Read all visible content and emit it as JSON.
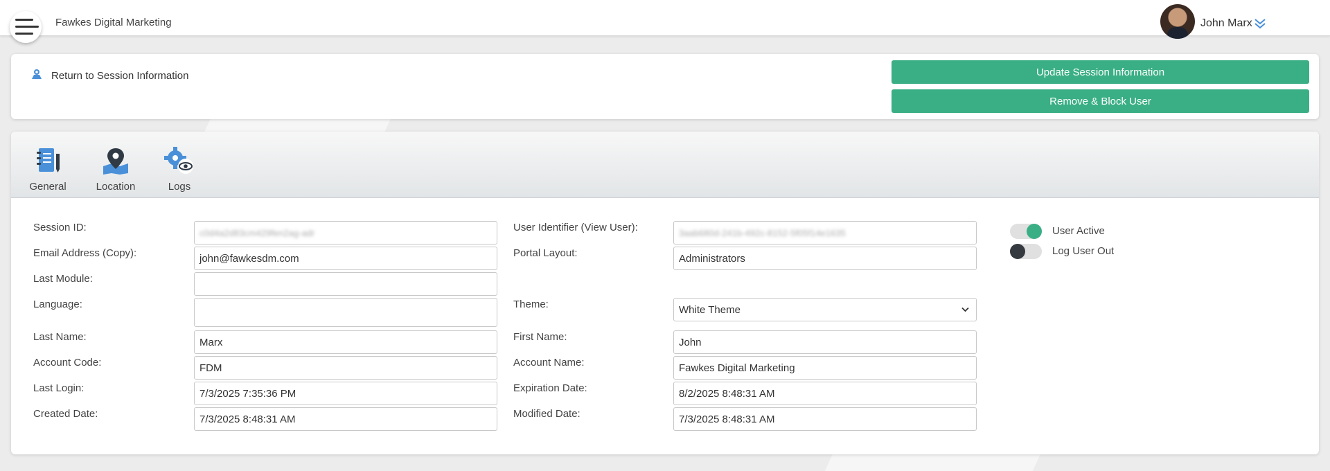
{
  "header": {
    "brand": "Fawkes Digital Marketing",
    "user_name": "John Marx"
  },
  "actions": {
    "return_label": "Return to Session Information",
    "update_label": "Update Session Information",
    "remove_label": "Remove & Block User"
  },
  "tabs": [
    {
      "label": "General",
      "icon": "notebook-icon"
    },
    {
      "label": "Location",
      "icon": "map-pin-icon"
    },
    {
      "label": "Logs",
      "icon": "gear-eye-icon"
    }
  ],
  "form": {
    "session_id": {
      "label": "Session ID:",
      "value": "c0d4a2d83cm429fen2ag-adr"
    },
    "user_identifier": {
      "label": "User Identifier (View User):",
      "value": "3aab680d-241b-492c-8152-5f05f14e1635"
    },
    "email": {
      "label": "Email Address (Copy):",
      "value": "john@fawkesdm.com"
    },
    "portal_layout": {
      "label": "Portal Layout:",
      "value": "Administrators"
    },
    "last_module": {
      "label": "Last Module:",
      "value": ""
    },
    "language": {
      "label": "Language:",
      "value": ""
    },
    "theme": {
      "label": "Theme:",
      "value": "White Theme"
    },
    "last_name": {
      "label": "Last Name:",
      "value": "Marx"
    },
    "first_name": {
      "label": "First Name:",
      "value": "John"
    },
    "account_code": {
      "label": "Account Code:",
      "value": "FDM"
    },
    "account_name": {
      "label": "Account Name:",
      "value": "Fawkes Digital Marketing"
    },
    "last_login": {
      "label": "Last Login:",
      "value": "7/3/2025 7:35:36 PM"
    },
    "expiration_date": {
      "label": "Expiration Date:",
      "value": "8/2/2025 8:48:31 AM"
    },
    "created_date": {
      "label": "Created Date:",
      "value": "7/3/2025 8:48:31 AM"
    },
    "modified_date": {
      "label": "Modified Date:",
      "value": "7/3/2025 8:48:31 AM"
    }
  },
  "toggles": {
    "user_active": {
      "label": "User Active",
      "state": "on"
    },
    "log_user_out": {
      "label": "Log User Out",
      "state": "off"
    }
  },
  "colors": {
    "accent_green": "#3aaf85",
    "icon_blue": "#4a90d9"
  }
}
